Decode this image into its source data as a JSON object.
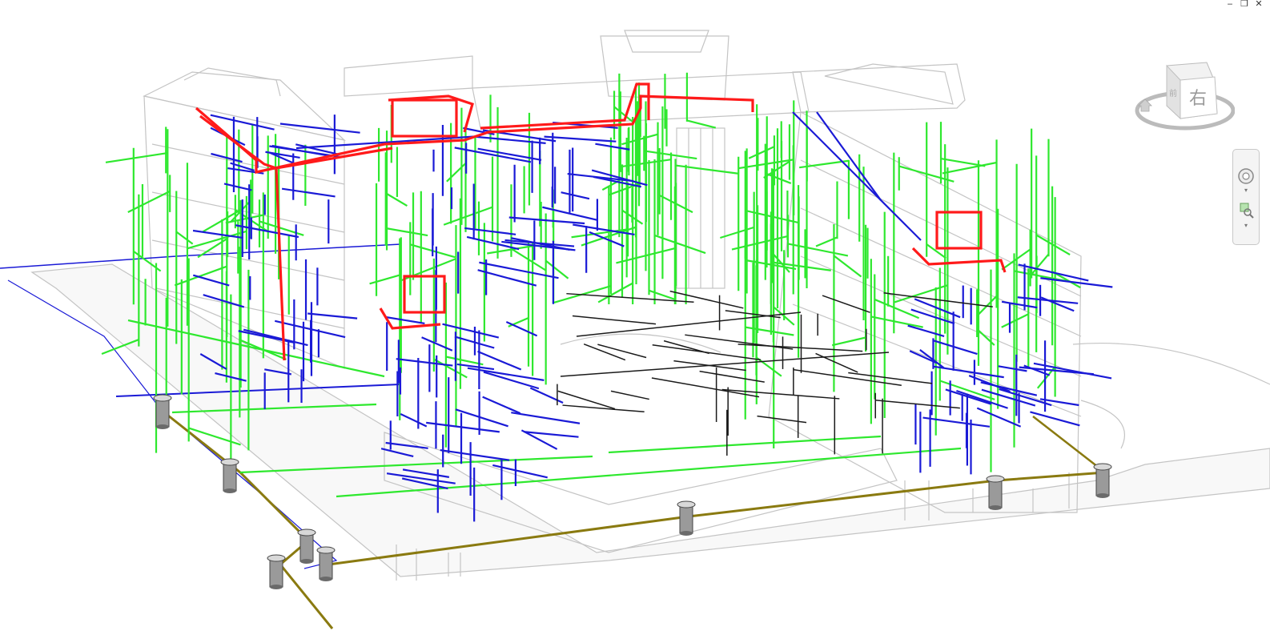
{
  "window_controls": {
    "minimize": "‒",
    "restore": "❐",
    "close": "✕"
  },
  "viewcube": {
    "face_label": "右",
    "side_label": "前",
    "icons": [
      "home-icon"
    ]
  },
  "navigation_bar": {
    "icons": [
      "steering-wheel-icon",
      "zoom-icon"
    ],
    "dropdown_glyph": "▾"
  },
  "colors": {
    "supply_pipe": "#ff1a1a",
    "return_pipe": "#1a1ad6",
    "drain_pipe": "#2ee82e",
    "misc_pipe": "#1a1a1a",
    "gas_line": "#8a7a10",
    "building_wireframe": "#c8c8c8",
    "tank": "#9a9a9a"
  }
}
